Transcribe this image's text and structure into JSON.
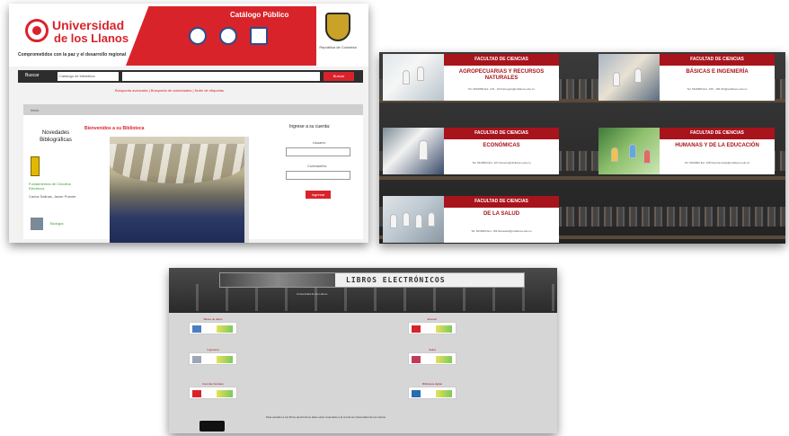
{
  "catalog": {
    "logo_line1": "Universidad",
    "logo_line2": "de los Llanos",
    "tagline": "Comprometidos con la paz y el desarrollo regional",
    "title": "Catálogo Público",
    "crest_caption": "República de Colombia",
    "search": {
      "label": "Buscar",
      "scope": "Catálogo de biblioteca",
      "button": "Buscar"
    },
    "links": "Búsqueda avanzada | Búsqueda de autoridades | Nube de etiquetas",
    "breadcrumb": "Inicio",
    "novedades_title": "Novedades Bibliográficas",
    "book1_title": "Fundamentos de Circuitos Eléctricos",
    "book1_author": "Carlos Salinas, Javier Puente",
    "book2_title": "Biología",
    "welcome": "Bienvenidos a su Biblioteca",
    "login_title": "Ingrese a su cuenta:",
    "user_label": "Usuario:",
    "password_label": "Contraseña:",
    "login_button": "Ingresar"
  },
  "faculties": {
    "cards": [
      {
        "header": "FACULTAD DE CIENCIAS",
        "name": "AGROPECUARIAS Y RECURSOS NATURALES",
        "info": "Tel: 6616800 Ext. 103 - 104  facuagro@unillanos.edu.co"
      },
      {
        "header": "FACULTAD DE CIENCIAS",
        "name": "BÁSICAS E INGENIERÍA",
        "info": "Tel: 6616800 Ext. 105 - 106  fcbi@unillanos.edu.co"
      },
      {
        "header": "FACULTAD DE CIENCIAS",
        "name": "ECONÓMICAS",
        "info": "Tel: 6616800 Ext. 107  facueco@unillanos.edu.co"
      },
      {
        "header": "FACULTAD DE CIENCIAS",
        "name": "HUMANAS Y DE LA EDUCACIÓN",
        "info": "Tel: 6616800 Ext. 108  facuhumanas@unillanos.edu.co"
      },
      {
        "header": "FACULTAD DE CIENCIAS",
        "name": "DE LA SALUD",
        "info": "Tel: 6616800 Ext. 109  facusalud@unillanos.edu.co"
      }
    ]
  },
  "ebooks": {
    "banner_title": "LIBROS ELECTRÓNICOS",
    "subtitle": "Universidad de los Llanos",
    "tiles": [
      {
        "caption": "Bases de datos"
      },
      {
        "caption": "Elsevier"
      },
      {
        "caption": "Ingeniería"
      },
      {
        "caption": "Salud"
      },
      {
        "caption": "Ciencias Sociales"
      },
      {
        "caption": "Biblioteca digital"
      }
    ],
    "note": "Para acceder a los libros electrónicos debe estar conectado a la red de la Universidad de los Llanos."
  },
  "colors": {
    "brand_red": "#d9232b",
    "faculty_red": "#a8141c",
    "dark": "#2d2d2d"
  }
}
